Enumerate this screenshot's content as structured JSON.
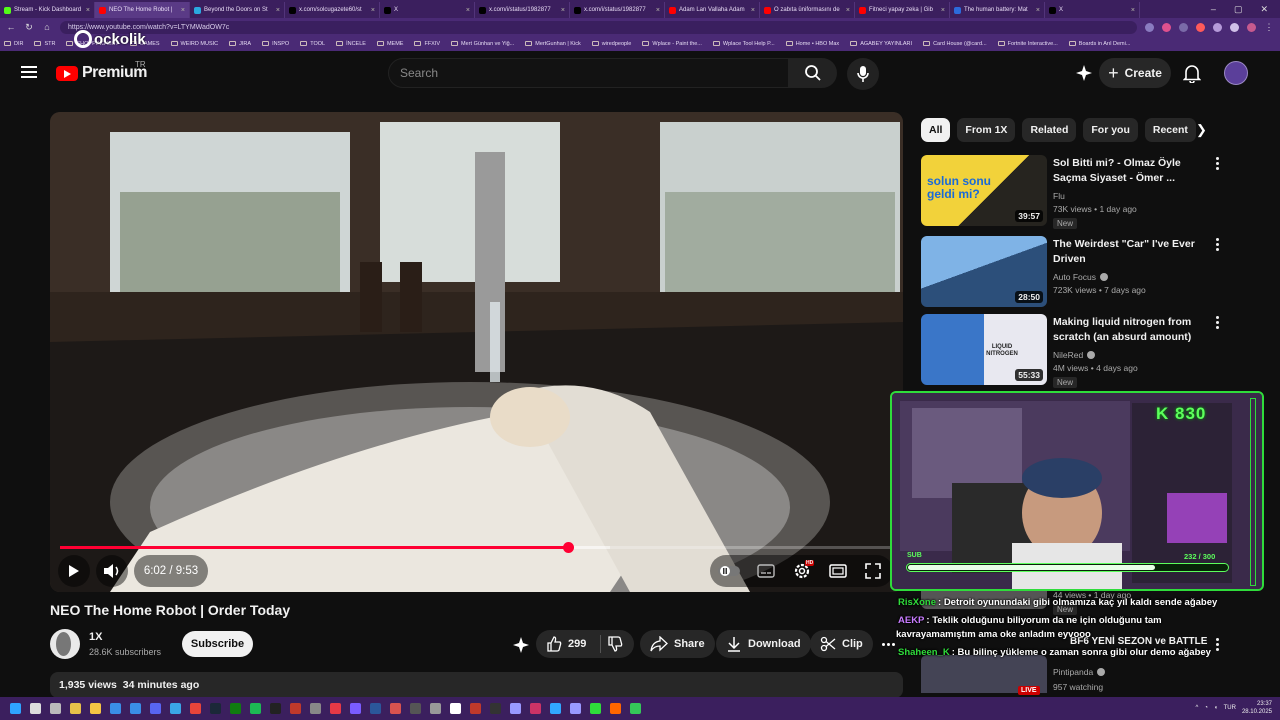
{
  "browser": {
    "tabs": [
      {
        "title": "Stream - Kick Dashboard",
        "color": "#53fc18",
        "active": false
      },
      {
        "title": "NEO The Home Robot |",
        "color": "#ff0000",
        "active": true
      },
      {
        "title": "Beyond the Doors on St",
        "color": "#2aa9e0",
        "active": false
      },
      {
        "title": "x.com/solcugazete60/st",
        "color": "#000000",
        "active": false
      },
      {
        "title": "X",
        "color": "#000000",
        "active": false
      },
      {
        "title": "x.com/i/status/1982877",
        "color": "#000000",
        "active": false
      },
      {
        "title": "x.com/i/status/1982877",
        "color": "#000000",
        "active": false
      },
      {
        "title": "Adam Lan Vallaha Adam",
        "color": "#ff0000",
        "active": false
      },
      {
        "title": "O zabıta üniformasını de",
        "color": "#ff0000",
        "active": false
      },
      {
        "title": "Fitneci yapay zeka | Gib",
        "color": "#ff0000",
        "active": false
      },
      {
        "title": "The human battery: Mat",
        "color": "#2c6bdb",
        "active": false
      },
      {
        "title": "X",
        "color": "#000000",
        "active": false
      }
    ],
    "url": "https://www.youtube.com/watch?v=LTYMWadOW7c",
    "bookmarks": [
      "DIR",
      "STR",
      "SHOPPING LIST",
      "GAMES",
      "WEIRD MUSIC",
      "JIRA",
      "INSPO",
      "TOOL",
      "İNCELE",
      "MEME",
      "FFXIV",
      "Mert Günhan ve Yiğ...",
      "MertGunhan | Kick",
      "wiredpeople",
      "Wplace - Paint the...",
      "Wplace Tool Help P...",
      "Home • HBO Max",
      "AGABEY YAYINLARI",
      "Card House (@card...",
      "Fortnite Interactive...",
      "Boards in Arıl Demi..."
    ],
    "overlay_logo": "ockolik"
  },
  "header": {
    "brand": "Premium",
    "region": "TR",
    "search_placeholder": "Search",
    "create_label": "Create"
  },
  "player": {
    "current_time": "6:02",
    "duration": "9:53",
    "time_display": "6:02 / 9:53",
    "progress_fraction": 0.61,
    "buffered_fraction": 0.66,
    "settings_badge": "HD"
  },
  "video": {
    "title": "NEO The Home Robot | Order Today",
    "channel": "1X",
    "subscribers": "28.6K subscribers",
    "subscribe_label": "Subscribe",
    "likes": "299",
    "share_label": "Share",
    "download_label": "Download",
    "clip_label": "Clip",
    "views": "1,935 views",
    "posted": "34 minutes ago"
  },
  "chips": [
    "All",
    "From 1X",
    "Related",
    "For you",
    "Recent"
  ],
  "recommendations": [
    {
      "title_l1": "Sol Bitti mi? - Olmaz Öyle",
      "title_l2": "Saçma Siyaset - Ömer ...",
      "channel": "Flu",
      "verified": false,
      "meta": "73K views • 1 day ago",
      "badge": "New",
      "duration": "39:57",
      "thumb_text": "solun sonu geldi mi?"
    },
    {
      "title_l1": "The Weirdest \"Car\" I've Ever",
      "title_l2": "Driven",
      "channel": "Auto Focus",
      "verified": true,
      "meta": "723K views • 7 days ago",
      "badge": "",
      "duration": "28:50",
      "thumb_text": ""
    },
    {
      "title_l1": "Making liquid nitrogen from",
      "title_l2": "scratch (an absurd amount)",
      "channel": "NileRed",
      "verified": true,
      "meta": "4M views • 4 days ago",
      "badge": "New",
      "duration": "55:33",
      "thumb_text": "LIQUID NITROGEN"
    }
  ],
  "partial_rec": {
    "meta_fragment": "44 views • 1 day ago",
    "badge": "New"
  },
  "live_rec": {
    "title_fragment": "BF6 YENİ SEZON ve BATTLE",
    "channel": "Pintipanda",
    "meta": "957 watching",
    "live_label": "LIVE"
  },
  "stream_overlay": {
    "kick_count": "K 830",
    "sub_label": "SUB",
    "sub_count": "232 / 300",
    "sub_fraction": 0.773
  },
  "chat": [
    {
      "user": "RisXone",
      "user_color": "#2fdc3b",
      "text": ": Detroit oyunundaki gibi olmamıza kaç yıl kaldı sende ağabey"
    },
    {
      "user": "AEKP",
      "user_color": "#c87cff",
      "text": ": Teklik olduğunu biliyorum da ne için olduğunu tam"
    },
    {
      "user": "",
      "user_color": "#ffffff",
      "text": "kavrayamamıştım ama oke anladım eyvooo"
    },
    {
      "user": "Shaheen_K",
      "user_color": "#2fdc3b",
      "text": ": Bu bilinç yükleme o zaman sonra gibi olur demo ağabey"
    }
  ],
  "taskbar": {
    "lang": "TUR",
    "time": "23:37",
    "date": "28.10.2025"
  }
}
